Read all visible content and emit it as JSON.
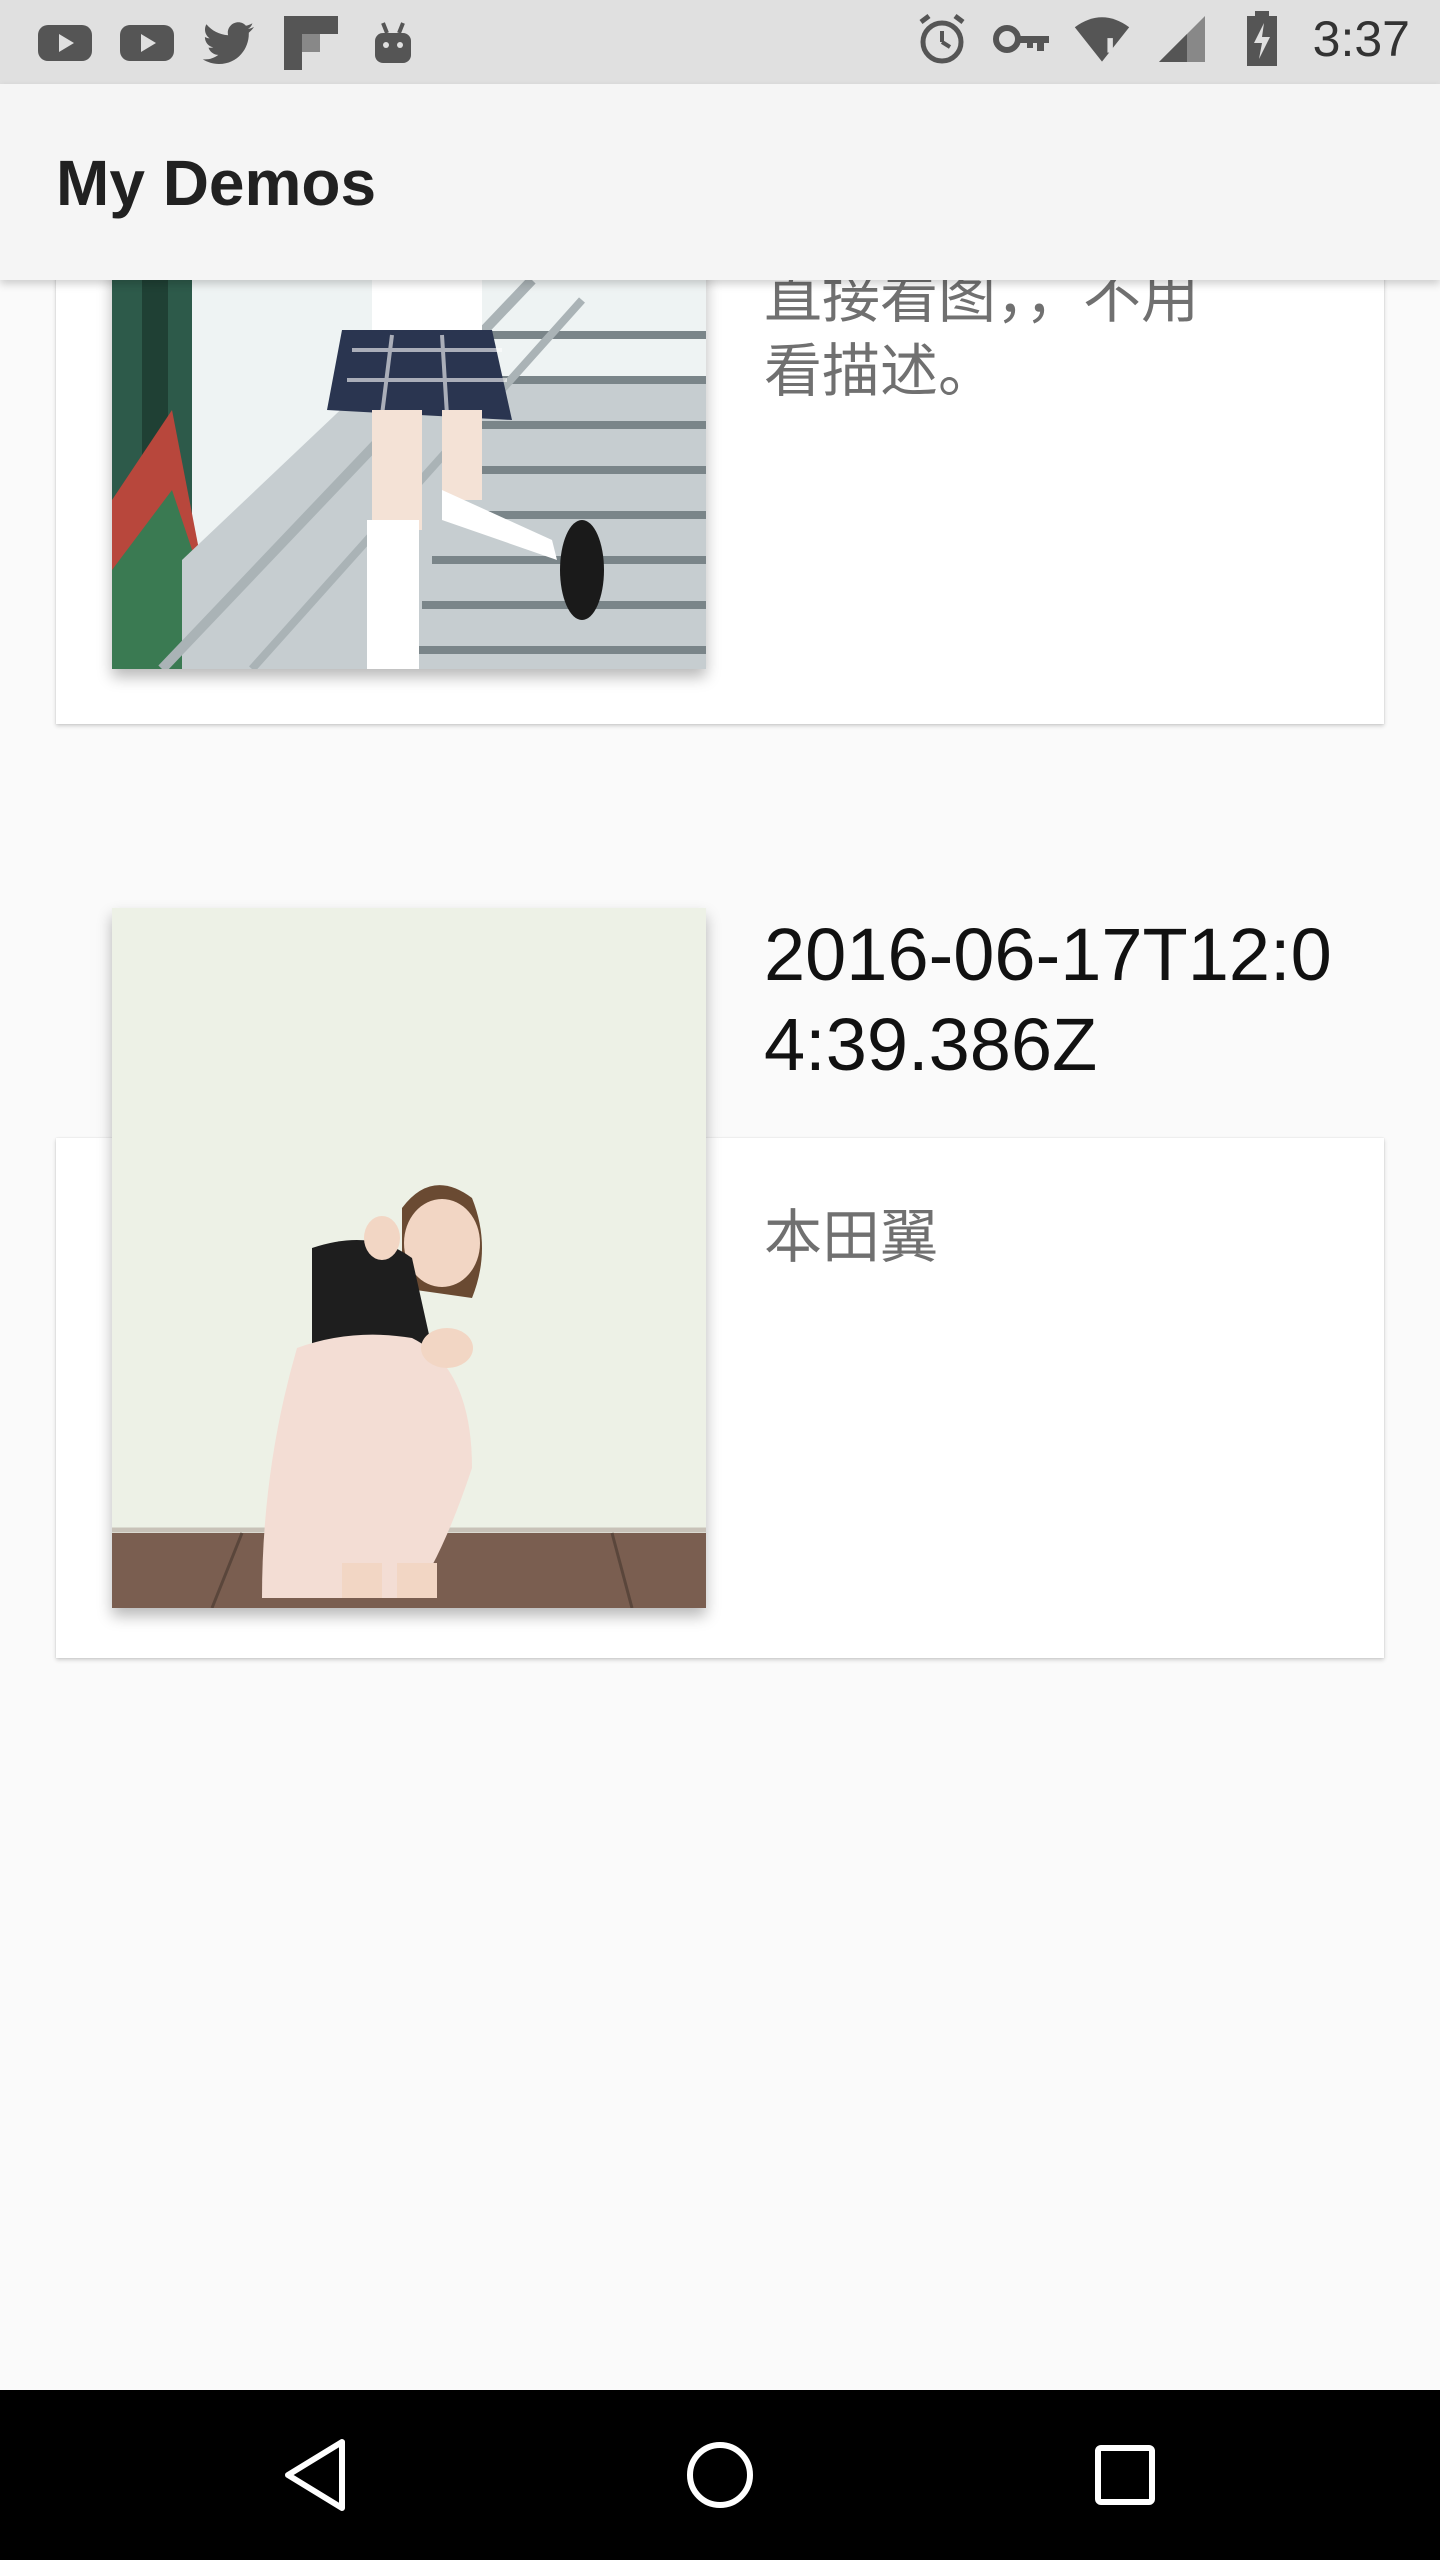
{
  "status_bar": {
    "time": "3:37",
    "left_icons": [
      "youtube-icon",
      "youtube-icon",
      "twitter-icon",
      "flipboard-icon",
      "android-icon"
    ],
    "right_icons": [
      "alarm-icon",
      "vpn-key-icon",
      "wifi-icon",
      "signal-icon",
      "battery-charging-icon"
    ]
  },
  "app_bar": {
    "title": "My Demos"
  },
  "cards": [
    {
      "title": "",
      "description": "直接看图，，不用\n看描述。"
    },
    {
      "title": "2016-06-17T12:04:39.386Z",
      "description": "本田翼"
    }
  ],
  "nav_bar": {
    "buttons": [
      "back-icon",
      "home-icon",
      "recents-icon"
    ]
  },
  "colors": {
    "status_bar": "#e0e0e0",
    "app_bar": "#f5f5f5",
    "background": "#fafafa",
    "nav_bar": "#000000"
  }
}
